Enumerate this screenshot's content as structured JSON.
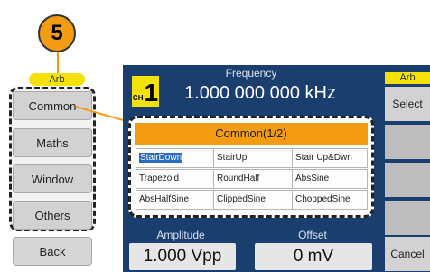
{
  "step": "5",
  "left_panel": {
    "tag": "Arb",
    "keys": [
      "Common",
      "Maths",
      "Window",
      "Others"
    ],
    "back": "Back"
  },
  "display": {
    "channel_small": "CH",
    "channel": "1",
    "frequency_label": "Frequency",
    "frequency_value": "1.000 000 000 kHz",
    "panel_title": "Common(1/2)",
    "options": [
      [
        "StairDown",
        "StairUp",
        "Stair Up&Dwn"
      ],
      [
        "Trapezoid",
        "RoundHalf",
        "AbsSine"
      ],
      [
        "AbsHalfSine",
        "ClippedSine",
        "ChoppedSine"
      ]
    ],
    "selected_option": "StairDown",
    "amplitude_label": "Amplitude",
    "amplitude_value": "1.000 Vpp",
    "offset_label": "Offset",
    "offset_value": "0 mV"
  },
  "right_panel": {
    "tag": "Arb",
    "select": "Select",
    "cancel": "Cancel"
  },
  "colors": {
    "accent_orange": "#f39c12",
    "tag_yellow": "#f4e10a",
    "screen_blue": "#1a3e6e",
    "selection_blue": "#2a6cc0"
  }
}
